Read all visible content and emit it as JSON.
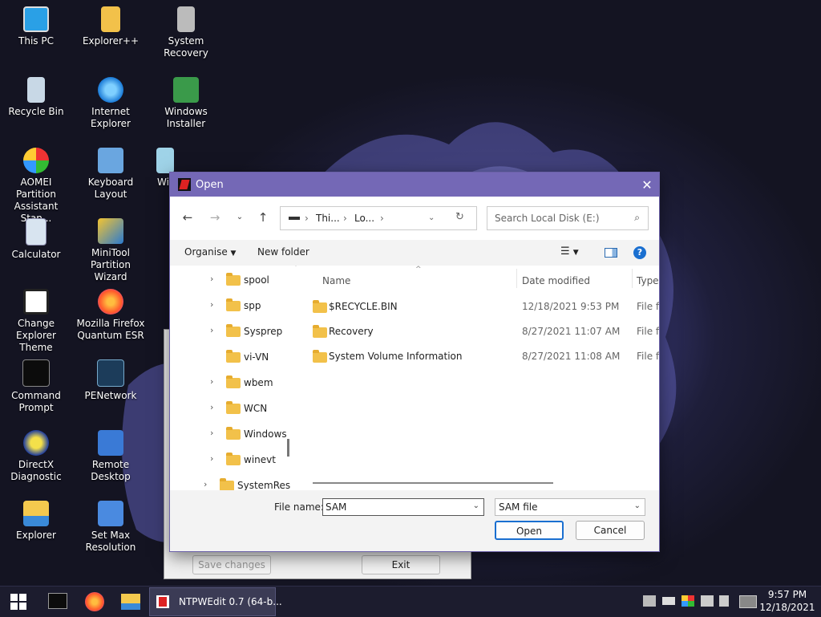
{
  "desktop": {
    "icons": [
      {
        "label": "This PC",
        "icon": "computer-icon"
      },
      {
        "label": "Explorer++",
        "icon": "folder-icon"
      },
      {
        "label": "System Recovery",
        "icon": "system-recovery-icon"
      },
      {
        "label": "Recycle Bin",
        "icon": "recycle-bin-icon"
      },
      {
        "label": "Internet Explorer",
        "icon": "internet-explorer-icon"
      },
      {
        "label": "Windows Installer",
        "icon": "windows-installer-icon"
      },
      {
        "label": "AOMEI Partition Assistant Stan...",
        "icon": "aomei-icon"
      },
      {
        "label": "Keyboard Layout",
        "icon": "keyboard-icon"
      },
      {
        "label": "Wi...",
        "icon": "window-icon"
      },
      {
        "label": "Calculator",
        "icon": "calculator-icon"
      },
      {
        "label": "MiniTool Partition Wizard",
        "icon": "minitool-icon"
      },
      {
        "label": "Change Explorer Theme",
        "icon": "monitor-icon"
      },
      {
        "label": "Mozilla Firefox Quantum ESR",
        "icon": "firefox-icon"
      },
      {
        "label": "Command Prompt",
        "icon": "cmd-icon"
      },
      {
        "label": "PENetwork",
        "icon": "network-icon"
      },
      {
        "label": "DirectX Diagnostic",
        "icon": "directx-icon"
      },
      {
        "label": "Remote Desktop",
        "icon": "remote-desktop-icon"
      },
      {
        "label": "Explorer",
        "icon": "explorer-folder-icon"
      },
      {
        "label": "Set Max Resolution",
        "icon": "resolution-icon"
      }
    ]
  },
  "back_window": {
    "save_label": "Save changes",
    "exit_label": "Exit"
  },
  "dialog": {
    "title": "Open",
    "close_glyph": "✕",
    "address": {
      "crumb1": "Thi...",
      "crumb2": "Lo..."
    },
    "search_placeholder": "Search Local Disk (E:)",
    "organise_label": "Organise",
    "new_folder_label": "New folder",
    "tree_items": [
      {
        "label": "spool",
        "expandable": true
      },
      {
        "label": "spp",
        "expandable": true
      },
      {
        "label": "Sysprep",
        "expandable": true
      },
      {
        "label": "vi-VN",
        "expandable": false
      },
      {
        "label": "wbem",
        "expandable": true
      },
      {
        "label": "WCN",
        "expandable": true
      },
      {
        "label": "Windows",
        "expandable": true
      },
      {
        "label": "winevt",
        "expandable": true
      },
      {
        "label": "SystemRes",
        "expandable": true
      }
    ],
    "columns": {
      "name": "Name",
      "date": "Date modified",
      "type": "Type"
    },
    "files": [
      {
        "name": "$RECYCLE.BIN",
        "date": "12/18/2021 9:53 PM",
        "type": "File fo"
      },
      {
        "name": "Recovery",
        "date": "8/27/2021 11:07 AM",
        "type": "File fo"
      },
      {
        "name": "System Volume Information",
        "date": "8/27/2021 11:08 AM",
        "type": "File fo"
      }
    ],
    "file_name_label": "File name:",
    "file_name_value": "SAM",
    "file_type_value": "SAM file",
    "open_label": "Open",
    "cancel_label": "Cancel"
  },
  "taskbar": {
    "app_label": "NTPWEdit 0.7 (64-b...",
    "time": "9:57 PM",
    "date": "12/18/2021"
  },
  "colors": {
    "title_bar": "#7468b6",
    "taskbar": "#1c1c2e"
  }
}
